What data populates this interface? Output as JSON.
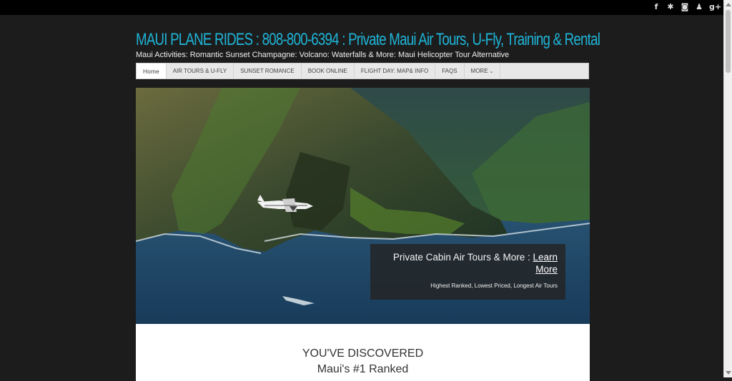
{
  "social_icons": [
    {
      "name": "facebook-icon",
      "glyph": "f"
    },
    {
      "name": "yelp-icon",
      "glyph": "✱"
    },
    {
      "name": "instagram-icon",
      "glyph": "◙"
    },
    {
      "name": "user-icon",
      "glyph": "♟"
    },
    {
      "name": "google-plus-icon",
      "glyph": "g+"
    }
  ],
  "header": {
    "title": "MAUI PLANE RIDES : 808-800-6394 : Private Maui Air Tours, U-Fly, Training & Rental",
    "tagline": "Maui Activities: Romantic Sunset Champagne: Volcano: Waterfalls & More: Maui Helicopter Tour Alternative"
  },
  "nav": {
    "items": [
      "Home",
      "AIR TOURS & U-FLY",
      "SUNSET ROMANCE",
      "BOOK ONLINE",
      "FLIGHT DAY: MAP& INFO",
      "FAQs",
      "MORE"
    ],
    "more_chevron": "⌄"
  },
  "hero": {
    "caption_text": "Private Cabin Air Tours & More :",
    "caption_link": "Learn More",
    "caption_sub": "Highest Ranked, Lowest Priced, Longest Air Tours"
  },
  "content": {
    "heading_line1": "YOU'VE DISCOVERED",
    "heading_line2": "Maui's #1 Ranked"
  },
  "colors": {
    "title": "#1fb4d6",
    "page_bg": "#1c1c1c",
    "nav_bg": "#e8e8e8"
  }
}
